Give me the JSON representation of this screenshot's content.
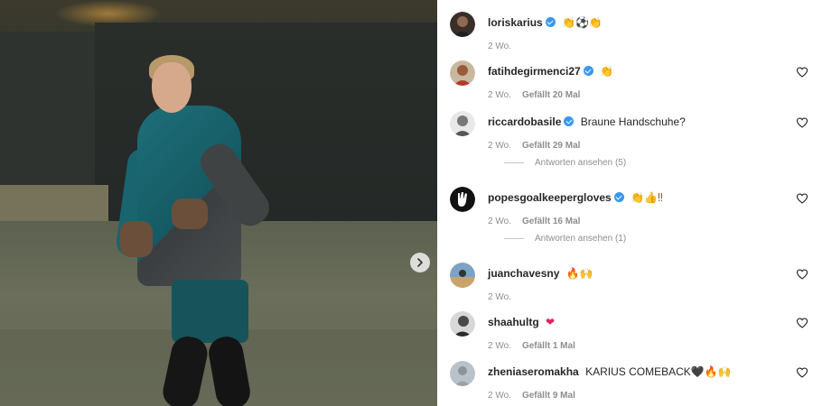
{
  "post": {
    "next_icon": "chevron-right-icon"
  },
  "colors": {
    "verified": "#3897f0",
    "meta_text": "#8e8e8e",
    "text": "#262626"
  },
  "comments": [
    {
      "username": "loriskarius",
      "verified": true,
      "text": "",
      "emojis": "👏⚽👏",
      "age": "2 Wo.",
      "likes": "",
      "has_like_button": false,
      "replies": ""
    },
    {
      "username": "fatihdegirmenci27",
      "verified": true,
      "text": "",
      "emojis": "👏",
      "age": "2 Wo.",
      "likes": "Gefällt 20 Mal",
      "has_like_button": true,
      "replies": ""
    },
    {
      "username": "riccardobasile",
      "verified": true,
      "text": "Braune Handschuhe?",
      "emojis": "",
      "age": "2 Wo.",
      "likes": "Gefällt 29 Mal",
      "has_like_button": true,
      "replies": "Antworten ansehen (5)"
    },
    {
      "username": "popesgoalkeepergloves",
      "verified": true,
      "text": "",
      "emojis": "👏👍‼",
      "age": "2 Wo.",
      "likes": "Gefällt 16 Mal",
      "has_like_button": true,
      "replies": "Antworten ansehen (1)"
    },
    {
      "username": "juanchavesny",
      "verified": false,
      "text": "",
      "emojis": "🔥🙌",
      "age": "2 Wo.",
      "likes": "",
      "has_like_button": true,
      "replies": ""
    },
    {
      "username": "shaahultg",
      "verified": false,
      "text": "",
      "emojis": "❤",
      "age": "2 Wo.",
      "likes": "Gefällt 1 Mal",
      "has_like_button": true,
      "replies": ""
    },
    {
      "username": "zheniaseromakha",
      "verified": false,
      "text": "KARIUS COMEBACK",
      "emojis": "🖤🔥🙌",
      "age": "2 Wo.",
      "likes": "Gefällt 9 Mal",
      "has_like_button": true,
      "replies": ""
    }
  ]
}
